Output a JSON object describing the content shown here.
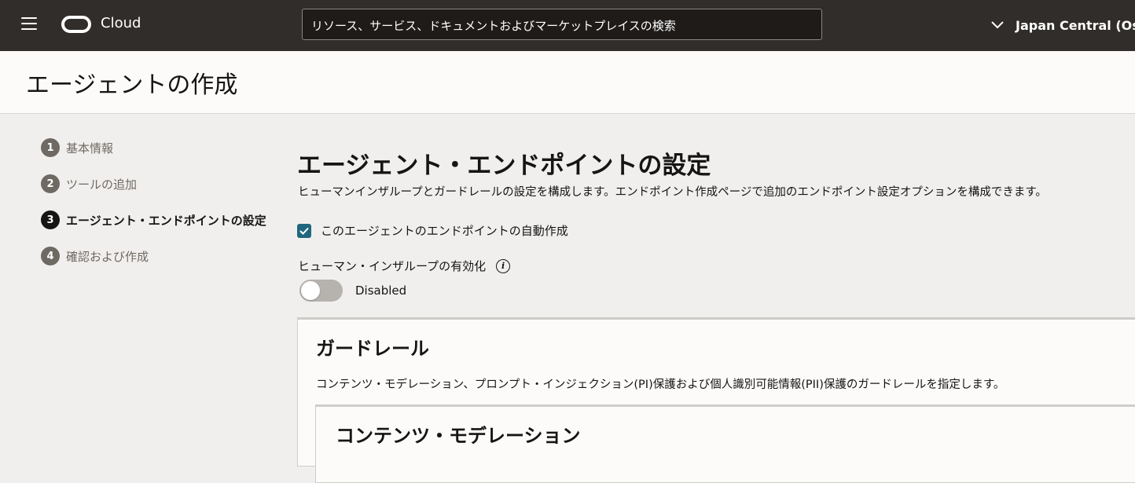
{
  "header": {
    "brand": "Cloud",
    "search_placeholder": "リソース、サービス、ドキュメントおよびマーケットプレイスの検索",
    "region": "Japan Central (Osa"
  },
  "page": {
    "title": "エージェントの作成"
  },
  "steps": [
    {
      "number": "1",
      "label": "基本情報",
      "active": false
    },
    {
      "number": "2",
      "label": "ツールの追加",
      "active": false
    },
    {
      "number": "3",
      "label": "エージェント・エンドポイントの設定",
      "active": true
    },
    {
      "number": "4",
      "label": "確認および作成",
      "active": false
    }
  ],
  "section": {
    "title": "エージェント・エンドポイントの設定",
    "description": "ヒューマンインザループとガードレールの設定を構成します。エンドポイント作成ページで追加のエンドポイント設定オプションを構成できます。",
    "auto_create_label": "このエージェントのエンドポイントの自動作成",
    "auto_create_checked": true,
    "hitl_label": "ヒューマン・インザループの有効化",
    "hitl_info_icon": "info-icon",
    "hitl_state": "Disabled"
  },
  "guardrails": {
    "title": "ガードレール",
    "description": "コンテンツ・モデレーション、プロンプト・インジェクション(PI)保護および個人識別可能情報(PII)保護のガードレールを指定します。",
    "content_moderation_title": "コンテンツ・モデレーション"
  },
  "colors": {
    "header_bg": "#312d2a",
    "accent": "#20677e",
    "active_step": "#161513"
  }
}
